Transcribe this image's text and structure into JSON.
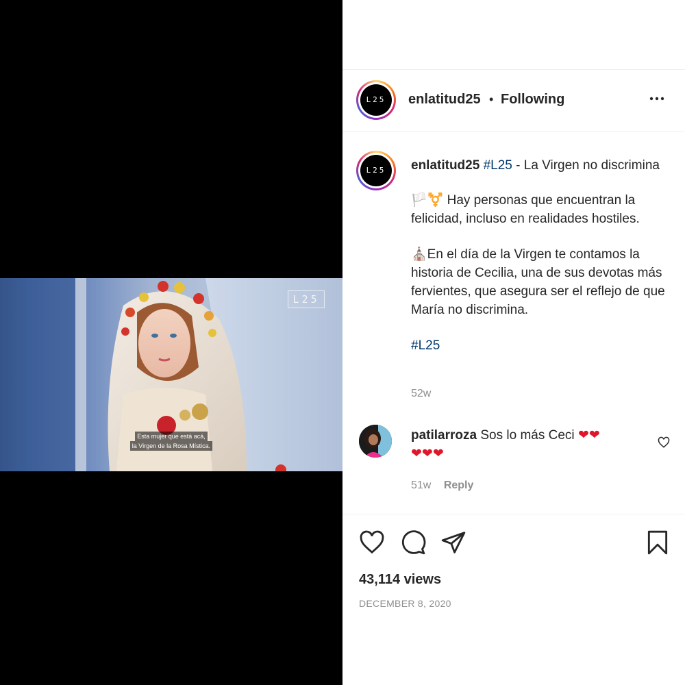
{
  "media": {
    "watermark": "L25",
    "subtitle_line1": "Esta mujer que está acá,",
    "subtitle_line2": "la Virgen de la Rosa Mística."
  },
  "header": {
    "avatar_text": "L25",
    "username": "enlatitud25",
    "separator": "•",
    "follow_status": "Following",
    "more_icon": "more-horizontal-icon"
  },
  "caption": {
    "avatar_text": "L25",
    "username": "enlatitud25",
    "hashtag": "#L25",
    "title_rest": " - La Virgen no discrimina",
    "para1_emoji": "🏳️⚧️",
    "para1": " Hay personas que encuentran la felicidad, incluso en realidades hostiles.",
    "para2_emoji": "⛪",
    "para2": "En el día de la Virgen te contamos la historia de Cecilia, una de sus devotas más fervientes, que asegura ser el reflejo de que María no discrimina.",
    "hashtag2": "#L25",
    "time": "52w"
  },
  "comment": {
    "username": "patilarroza",
    "text": "Sos lo más Ceci",
    "hearts_inline": "❤❤",
    "hearts_line2": "❤❤❤",
    "time": "51w",
    "reply": "Reply"
  },
  "actions": {
    "like_icon": "heart-icon",
    "comment_icon": "comment-icon",
    "share_icon": "send-icon",
    "save_icon": "bookmark-icon",
    "views": "43,114 views",
    "date": "DECEMBER 8, 2020"
  },
  "colors": {
    "text": "#262626",
    "muted": "#8e8e8e",
    "link": "#00376b",
    "heart": "#e0162b",
    "border": "#efefef"
  }
}
